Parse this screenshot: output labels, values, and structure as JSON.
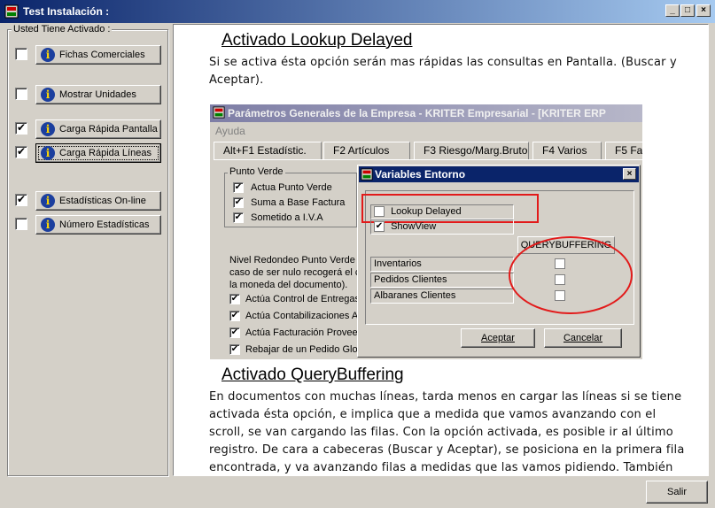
{
  "window": {
    "title": "Test Instalación :",
    "min_label": "_",
    "max_label": "□",
    "close_label": "×"
  },
  "sidebar": {
    "group_label": "Usted Tiene Activado :",
    "items": [
      {
        "label": "Fichas Comerciales",
        "checked": ""
      },
      {
        "label": "Mostrar Unidades",
        "checked": ""
      },
      {
        "label": "Carga Rápida Pantalla",
        "checked": "✔"
      },
      {
        "label": "Carga Rápida Líneas",
        "checked": "✔"
      },
      {
        "label": "Estadísticas On-line",
        "checked": "✔"
      },
      {
        "label": "Número Estadísticas",
        "checked": ""
      }
    ],
    "info_glyph": "i"
  },
  "content": {
    "heading1": "Activado Lookup Delayed",
    "para1_line1": "Si se activa ésta opción serán mas rápidas las consultas en Pantalla. (Buscar y",
    "para1_line2": "Aceptar).",
    "heading2": "Activado QueryBuffering",
    "para2_lines": [
      "En documentos con muchas líneas, tarda menos en cargar las líneas si se tiene",
      "activada ésta opción, e implica que a medida que vamos avanzando con el",
      "scroll, se van cargando las filas. Con la opción activada, es posible ir al último",
      "registro. De cara a cabeceras (Buscar y Aceptar), se posiciona en la primera fila",
      "encontrada, y va avanzando filas a medidas que las vamos pidiendo. También"
    ]
  },
  "screenshot": {
    "title": "Parámetros Generales de la Empresa - KRITER Empresarial - [KRITER ERP",
    "menu": "Ayuda",
    "tabs": [
      "Alt+F1 Estadístic.",
      "F2 Artículos",
      "F3 Riesgo/Marg.Bruto",
      "F4 Varios",
      "F5 Fa"
    ],
    "punto_verde_label": "Punto Verde",
    "punto_items": [
      "Actua Punto Verde",
      "Suma a Base Factura",
      "Sometido a I.V.A"
    ],
    "redondeo_lines": [
      "Nivel Redondeo Punto Verde",
      "caso de ser nulo recogerá el c",
      "la moneda del documento)."
    ],
    "actua_items": [
      "Actúa Control de Entregas",
      "Actúa Contabilizaciones A",
      "Actúa Facturación Provee",
      "Rebajar de un Pedido Glo"
    ],
    "dialog": {
      "title": "Variables Entorno",
      "close_label": "×",
      "lookup_label": "Lookup Delayed",
      "showview_label": "ShowView",
      "querybuffering_label": "QUERYBUFFERING",
      "rows": [
        "Inventarios",
        "Pedidos Clientes",
        "Albaranes Clientes"
      ],
      "accept_label": "Aceptar",
      "cancel_label": "Cancelar"
    }
  },
  "footer": {
    "exit_label": "Salir"
  }
}
